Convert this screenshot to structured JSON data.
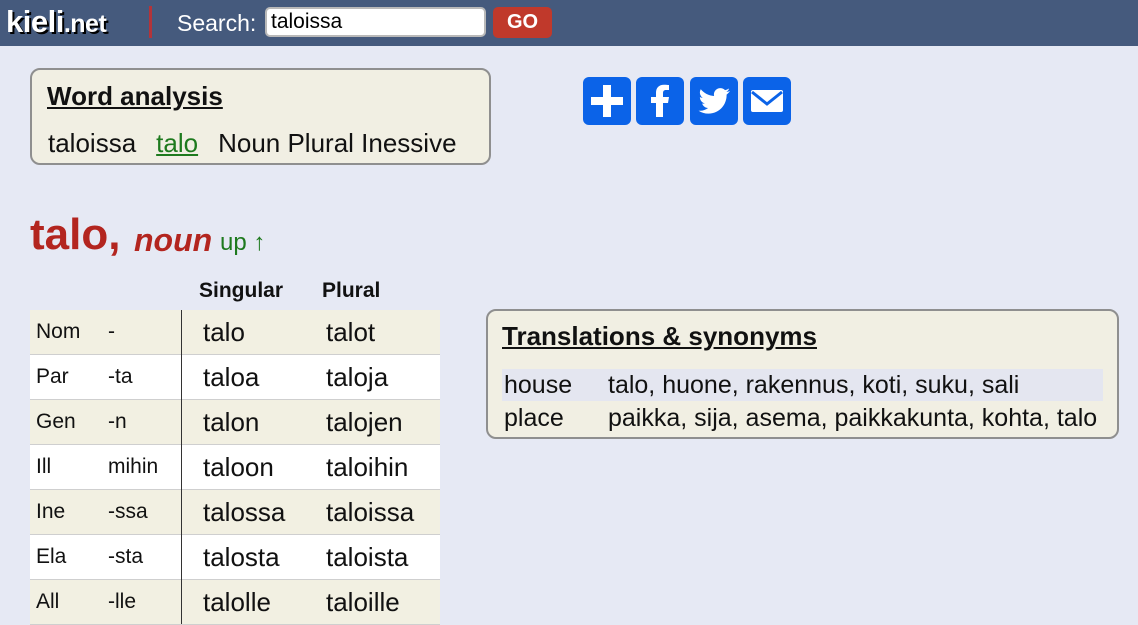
{
  "header": {
    "logo_main": "kieli",
    "logo_tld": ".net",
    "search_label": "Search:",
    "search_value": "taloissa",
    "go_label": "GO"
  },
  "analysis": {
    "title": "Word analysis",
    "word": "taloissa",
    "lemma": "talo",
    "tags": "Noun Plural Inessive"
  },
  "share": {
    "buttons": [
      "plus-icon",
      "facebook-icon",
      "twitter-icon",
      "email-icon"
    ],
    "color": "#0b63e8"
  },
  "entry": {
    "headword": "talo,",
    "pos": "noun",
    "up_label": "up ↑",
    "headword_color": "#b3251f",
    "link_color": "#1e7a1e"
  },
  "inflection": {
    "col_singular": "Singular",
    "col_plural": "Plural",
    "rows": [
      {
        "case": "Nom",
        "ending": "-",
        "sg": "talo",
        "pl": "talot"
      },
      {
        "case": "Par",
        "ending": "-ta",
        "sg": "taloa",
        "pl": "taloja"
      },
      {
        "case": "Gen",
        "ending": "-n",
        "sg": "talon",
        "pl": "talojen"
      },
      {
        "case": "Ill",
        "ending": "mihin",
        "sg": "taloon",
        "pl": "taloihin"
      },
      {
        "case": "Ine",
        "ending": "-ssa",
        "sg": "talossa",
        "pl": "taloissa"
      },
      {
        "case": "Ela",
        "ending": "-sta",
        "sg": "talosta",
        "pl": "taloista"
      },
      {
        "case": "All",
        "ending": "-lle",
        "sg": "talolle",
        "pl": "taloille"
      }
    ]
  },
  "translations": {
    "title": "Translations & synonyms",
    "rows": [
      {
        "en": "house",
        "fi": "talo, huone, rakennus, koti, suku, sali"
      },
      {
        "en": "place",
        "fi": "paikka, sija, asema, paikkakunta, kohta, talo"
      }
    ]
  }
}
